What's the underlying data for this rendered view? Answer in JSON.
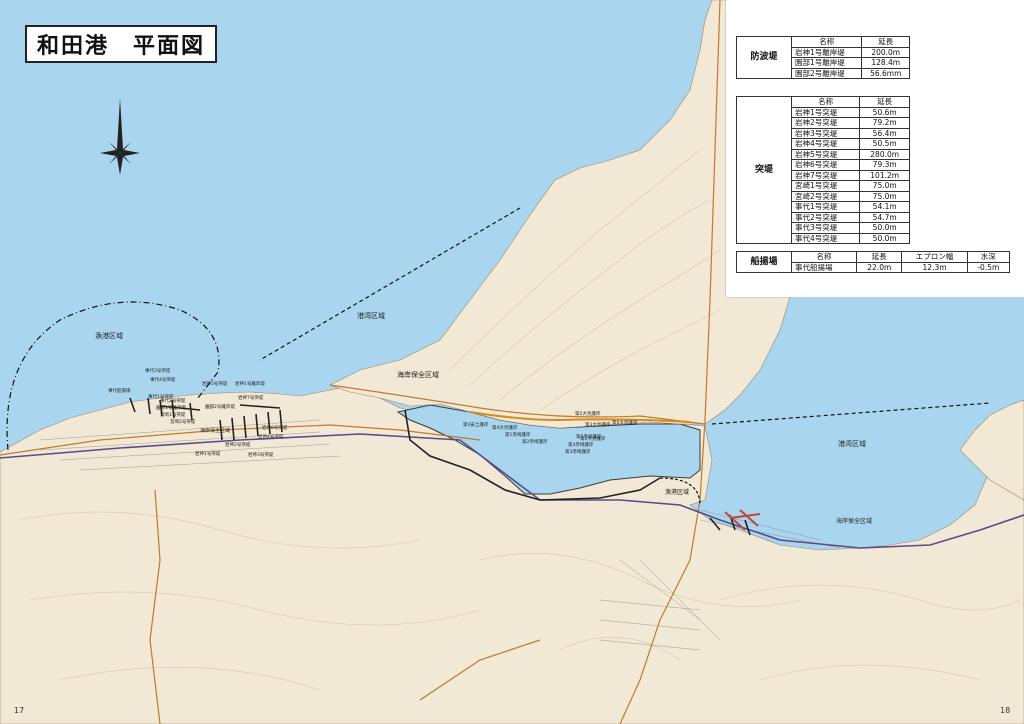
{
  "title": "和田港　平面図",
  "breakwater": {
    "category": "防波堤",
    "headers": [
      "名称",
      "延長"
    ],
    "rows": [
      [
        "岩神1号離岸堤",
        "200.0m"
      ],
      [
        "園部1号離岸堤",
        "128.4m"
      ],
      [
        "園部2号離岸堤",
        "56.6mm"
      ]
    ]
  },
  "jetty": {
    "category": "突堤",
    "headers": [
      "名称",
      "延長"
    ],
    "rows": [
      [
        "岩神1号突堤",
        "50.6m"
      ],
      [
        "岩神2号突堤",
        "79.2m"
      ],
      [
        "岩神3号突堤",
        "56.4m"
      ],
      [
        "岩神4号突堤",
        "50.5m"
      ],
      [
        "岩神5号突堤",
        "280.0m"
      ],
      [
        "岩神6号突堤",
        "79.3m"
      ],
      [
        "岩神7号突堤",
        "101.2m"
      ],
      [
        "宮崎1号突堤",
        "75.0m"
      ],
      [
        "宮崎2号突堤",
        "75.0m"
      ],
      [
        "事代1号突堤",
        "54.1m"
      ],
      [
        "事代2号突堤",
        "54.7m"
      ],
      [
        "事代3号突堤",
        "50.0m"
      ],
      [
        "事代4号突堤",
        "50.0m"
      ]
    ]
  },
  "slipway": {
    "category": "船揚場",
    "headers": [
      "名称",
      "延長",
      "エプロン幅",
      "水深"
    ],
    "rows": [
      [
        "事代船揚場",
        "22.0m",
        "12.3m",
        "-0.5m"
      ]
    ]
  },
  "map_labels": {
    "fishing_port_area": "漁港区域",
    "harbor_area_1": "港湾区域",
    "harbor_area_2": "港湾区域",
    "coast_area_1": "海岸保全区域",
    "coast_area_2": "海岸保全区域",
    "coast_area_3": "海岸保全区域",
    "fishing_port_area_2": "漁港区域",
    "jetty_labels": [
      "事代3号突堤",
      "事代4号突堤",
      "事代船揚場",
      "事代1号突堤",
      "事代2号突堤",
      "園部1号離岸堤",
      "宮崎1号突堤",
      "宮崎2号突堤",
      "岩神1号突堤",
      "岩神2号突堤",
      "岩神3号突堤",
      "岩神4号突堤",
      "岩神5号突堤",
      "岩神6号突堤",
      "岩神7号突堤",
      "岩神1号離岸堤",
      "園部2号離岸堤"
    ],
    "revetment_labels": [
      "第1大見護岸",
      "第2大見護岸",
      "第3大見護岸",
      "第4大見護岸",
      "第1赤崎護岸",
      "第2赤崎護岸",
      "第3赤崎護岸",
      "第4赤崎護岸",
      "第5赤崎護岸",
      "第6大見護岸",
      "第4安土護岸"
    ]
  },
  "page_left": "17",
  "page_right": "18",
  "colors": {
    "sea": "#a9d6ee",
    "land": "#f1e8d6",
    "contour": "#d9c6a4",
    "road": "#c07a2c",
    "rail": "#5a4a8a"
  }
}
